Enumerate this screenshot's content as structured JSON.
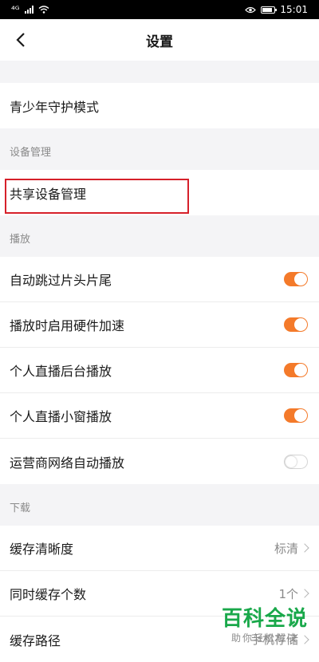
{
  "status_bar": {
    "carrier": "⁴ᴳ",
    "time": "15:01"
  },
  "nav": {
    "title": "设置"
  },
  "teen_mode": {
    "label": "青少年守护模式"
  },
  "device_section": {
    "header": "设备管理",
    "items": [
      {
        "label": "共享设备管理"
      }
    ]
  },
  "playback_section": {
    "header": "播放",
    "items": [
      {
        "label": "自动跳过片头片尾",
        "on": true
      },
      {
        "label": "播放时启用硬件加速",
        "on": true
      },
      {
        "label": "个人直播后台播放",
        "on": true
      },
      {
        "label": "个人直播小窗播放",
        "on": true
      },
      {
        "label": "运营商网络自动播放",
        "on": false
      }
    ]
  },
  "download_section": {
    "header": "下载",
    "items": [
      {
        "label": "缓存清晰度",
        "value": "标清"
      },
      {
        "label": "同时缓存个数",
        "value": "1个"
      },
      {
        "label": "缓存路径",
        "value": "手机存储"
      }
    ]
  },
  "watermark": {
    "title": "百科全说",
    "subtitle": "助你轻松解决"
  },
  "colors": {
    "accent": "#f47a2a",
    "highlight": "#d6202a",
    "watermark": "#19a84a"
  }
}
